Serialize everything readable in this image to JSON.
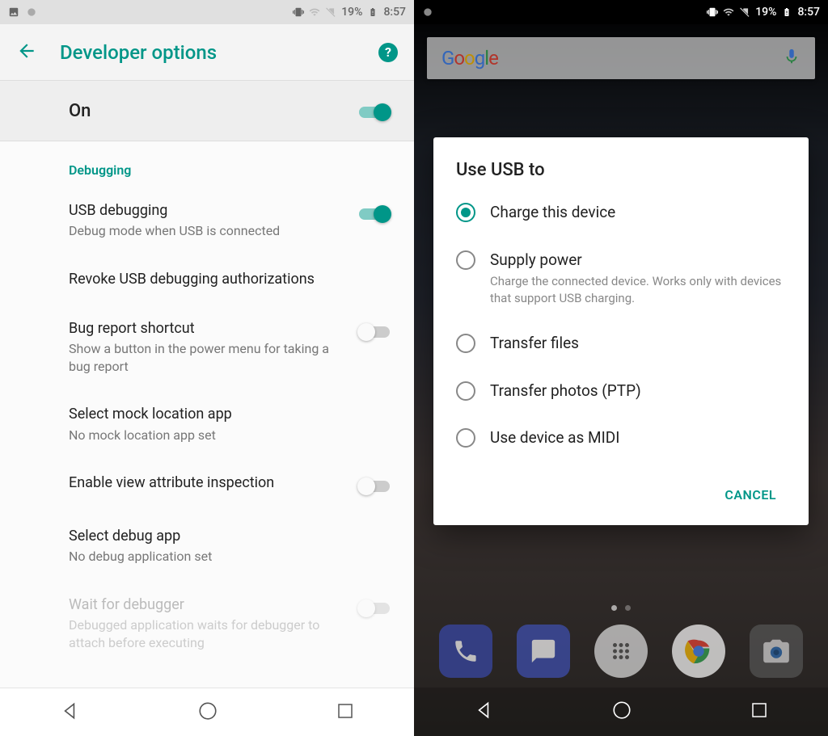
{
  "status": {
    "battery_pct": "19%",
    "time": "8:57"
  },
  "left": {
    "title": "Developer options",
    "master": {
      "label": "On",
      "on": true
    },
    "section": "Debugging",
    "items": [
      {
        "title": "USB debugging",
        "sub": "Debug mode when USB is connected",
        "switch": "on"
      },
      {
        "title": "Revoke USB debugging authorizations",
        "sub": "",
        "switch": null
      },
      {
        "title": "Bug report shortcut",
        "sub": "Show a button in the power menu for taking a bug report",
        "switch": "off"
      },
      {
        "title": "Select mock location app",
        "sub": "No mock location app set",
        "switch": null
      },
      {
        "title": "Enable view attribute inspection",
        "sub": "",
        "switch": "off"
      },
      {
        "title": "Select debug app",
        "sub": "No debug application set",
        "switch": null
      },
      {
        "title": "Wait for debugger",
        "sub": "Debugged application waits for debugger to attach before executing",
        "switch": "off",
        "disabled": true
      }
    ]
  },
  "right": {
    "search_brand": "Google",
    "dialog": {
      "title": "Use USB to",
      "options": [
        {
          "label": "Charge this device",
          "sub": "",
          "selected": true
        },
        {
          "label": "Supply power",
          "sub": "Charge the connected device. Works only with devices that support USB charging.",
          "selected": false
        },
        {
          "label": "Transfer files",
          "sub": "",
          "selected": false
        },
        {
          "label": "Transfer photos (PTP)",
          "sub": "",
          "selected": false
        },
        {
          "label": "Use device as MIDI",
          "sub": "",
          "selected": false
        }
      ],
      "cancel": "CANCEL"
    }
  }
}
